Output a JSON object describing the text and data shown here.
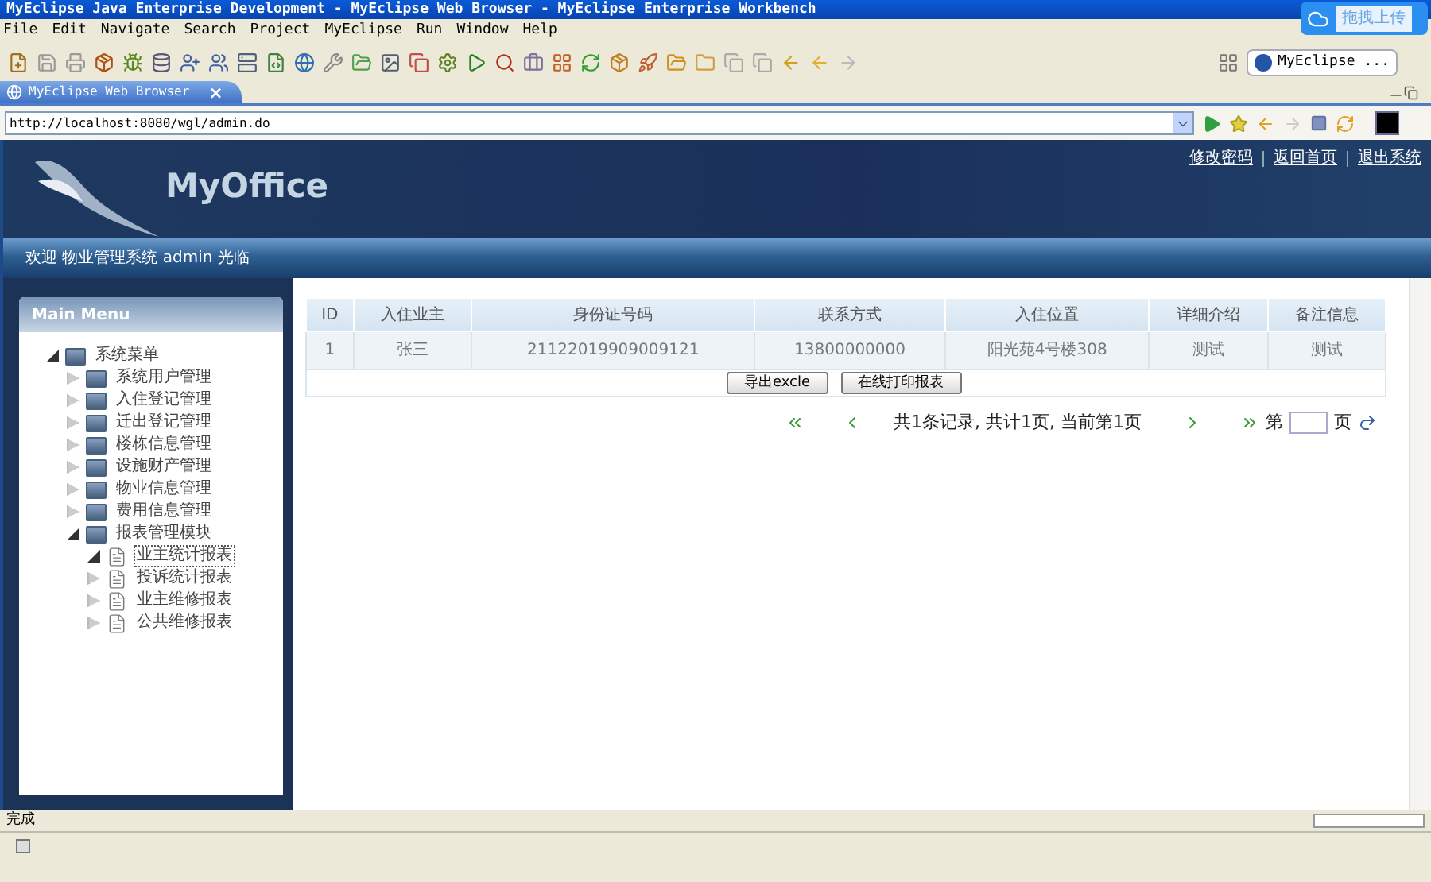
{
  "window": {
    "title": "MyEclipse Java Enterprise Development - MyEclipse Web Browser - MyEclipse Enterprise Workbench"
  },
  "upload_widget": {
    "label": "拖拽上传"
  },
  "menu_bar": [
    "File",
    "Edit",
    "Navigate",
    "Search",
    "Project",
    "MyEclipse",
    "Run",
    "Window",
    "Help"
  ],
  "perspective": {
    "label": "MyEclipse ..."
  },
  "editor_tab": {
    "label": "MyEclipse Web Browser",
    "close": "×"
  },
  "address_bar": {
    "value": "http://localhost:8080/wgl/admin.do"
  },
  "header": {
    "logo": "MyOffice",
    "links": [
      "修改密码",
      "返回首页",
      "退出系统"
    ],
    "welcome": "欢迎 物业管理系统 admin 光临"
  },
  "sidebar": {
    "title": "Main Menu",
    "tree": [
      {
        "label": "系统菜单",
        "kind": "folder",
        "expanded": true,
        "selected": false,
        "children": [
          {
            "label": "系统用户管理",
            "kind": "folder",
            "expanded": false,
            "selected": false
          },
          {
            "label": "入住登记管理",
            "kind": "folder",
            "expanded": false,
            "selected": false
          },
          {
            "label": "迁出登记管理",
            "kind": "folder",
            "expanded": false,
            "selected": false
          },
          {
            "label": "楼栋信息管理",
            "kind": "folder",
            "expanded": false,
            "selected": false
          },
          {
            "label": "设施财产管理",
            "kind": "folder",
            "expanded": false,
            "selected": false
          },
          {
            "label": "物业信息管理",
            "kind": "folder",
            "expanded": false,
            "selected": false
          },
          {
            "label": "费用信息管理",
            "kind": "folder",
            "expanded": false,
            "selected": false
          },
          {
            "label": "报表管理模块",
            "kind": "folder",
            "expanded": true,
            "selected": false,
            "children": [
              {
                "label": "业主统计报表",
                "kind": "file",
                "expanded": true,
                "selected": true
              },
              {
                "label": "投诉统计报表",
                "kind": "file",
                "expanded": false,
                "selected": false
              },
              {
                "label": "业主维修报表",
                "kind": "file",
                "expanded": false,
                "selected": false
              },
              {
                "label": "公共维修报表",
                "kind": "file",
                "expanded": false,
                "selected": false
              }
            ]
          }
        ]
      }
    ]
  },
  "table": {
    "columns": [
      "ID",
      "入住业主",
      "身份证号码",
      "联系方式",
      "入住位置",
      "详细介绍",
      "备注信息"
    ],
    "rows": [
      [
        "1",
        "张三",
        "21122019909009121",
        "13800000000",
        "阳光苑4号楼308",
        "测试",
        "测试"
      ]
    ],
    "buttons": [
      "导出excle",
      "在线打印报表"
    ]
  },
  "pagination": {
    "summary": "共1条记录, 共计1页, 当前第1页",
    "page_prefix": "第",
    "page_suffix": "页"
  },
  "status_bar": {
    "text": "完成"
  }
}
